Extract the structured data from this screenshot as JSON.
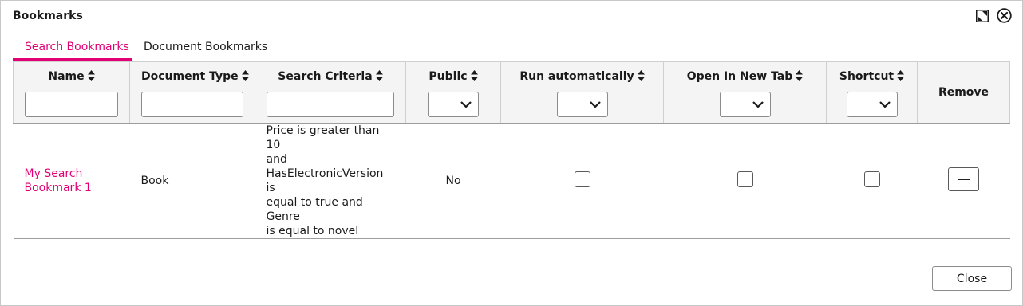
{
  "dialog": {
    "title": "Bookmarks",
    "close_label": "Close"
  },
  "tabs": [
    {
      "label": "Search Bookmarks",
      "active": true
    },
    {
      "label": "Document Bookmarks",
      "active": false
    }
  ],
  "columns": [
    {
      "label": "Name",
      "sortable": true,
      "filter": "text"
    },
    {
      "label": "Document Type",
      "sortable": true,
      "filter": "text"
    },
    {
      "label": "Search Criteria",
      "sortable": true,
      "filter": "text"
    },
    {
      "label": "Public",
      "sortable": true,
      "filter": "select"
    },
    {
      "label": "Run automatically",
      "sortable": true,
      "filter": "select"
    },
    {
      "label": "Open In New Tab",
      "sortable": true,
      "filter": "select"
    },
    {
      "label": "Shortcut",
      "sortable": true,
      "filter": "select"
    },
    {
      "label": "Remove",
      "sortable": false,
      "filter": "none"
    }
  ],
  "rows": [
    {
      "name_line1": "My Search",
      "name_line2": "Bookmark 1",
      "document_type": "Book",
      "criteria_lines": [
        "Price is greater than 10",
        "and",
        "HasElectronicVersion is",
        "equal to true and Genre",
        "is equal to novel"
      ],
      "public": "No",
      "run_automatically": false,
      "open_in_new_tab": false,
      "shortcut": false
    }
  ],
  "colors": {
    "accent": "#e20074",
    "header_bg": "#f4f4f4"
  }
}
